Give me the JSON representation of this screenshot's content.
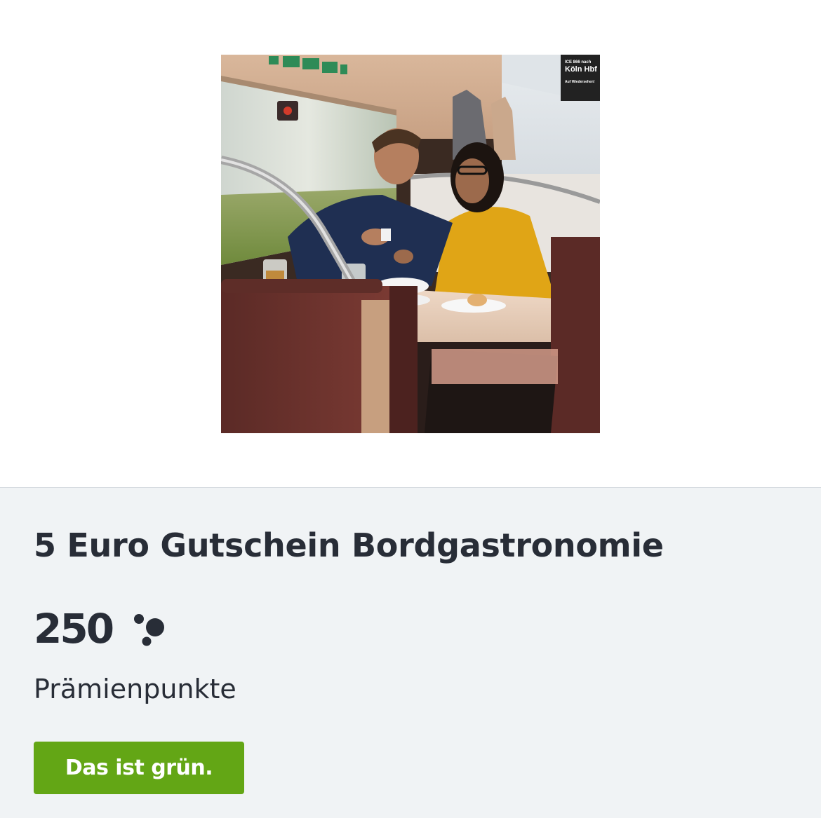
{
  "product": {
    "image_alt": "Paar im Bordrestaurant eines ICE",
    "image_sign": {
      "small_label": "ICE 866 nach",
      "destination": "Köln Hbf",
      "subline": "Auf Wiedersehen!"
    },
    "title": "5 Euro Gutschein Bordgastronomie",
    "points": "250",
    "points_icon": "bonus-points-icon",
    "points_label": "Prämienpunkte",
    "badge_label": "Das ist grün."
  },
  "colors": {
    "panel_background": "#f0f3f5",
    "text": "#282d37",
    "green": "#63a615"
  }
}
